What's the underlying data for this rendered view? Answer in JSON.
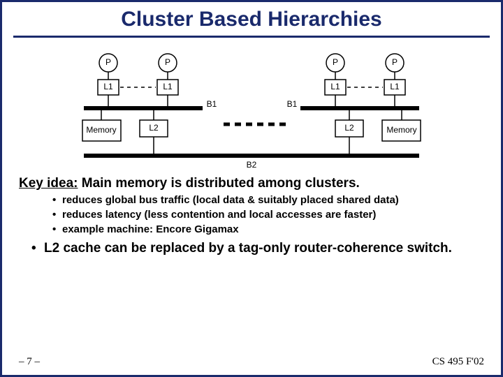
{
  "title": "Cluster Based Hierarchies",
  "diagram": {
    "P": "P",
    "L1": "L1",
    "L2": "L2",
    "Memory": "Memory",
    "B1": "B1",
    "B2": "B2"
  },
  "key_label": "Key idea:",
  "key_text": " Main memory is distributed among clusters.",
  "sub_bullets": [
    "reduces global bus traffic (local data & suitably placed shared data)",
    "reduces latency (less contention and local accesses are faster)",
    "example machine: Encore Gigamax"
  ],
  "main_bullet": "L2 cache can be replaced by a tag-only router-coherence switch.",
  "footer_left": "– 7 –",
  "footer_right": "CS 495 F'02"
}
